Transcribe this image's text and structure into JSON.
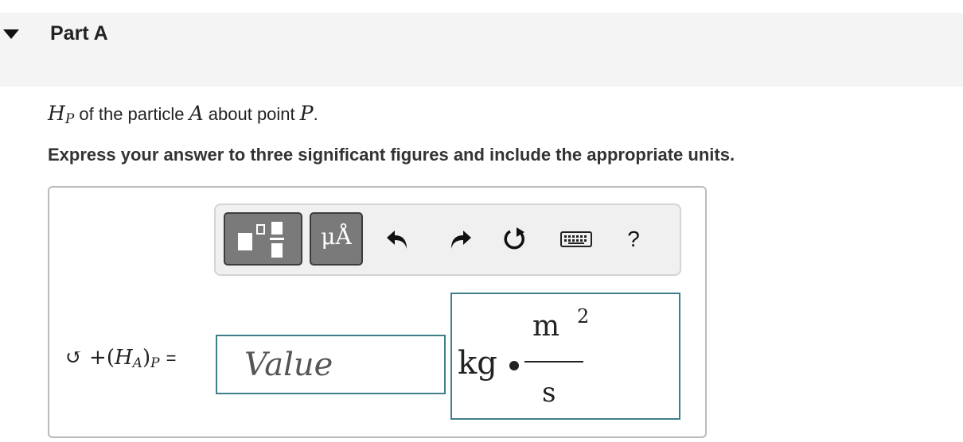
{
  "part": {
    "title": "Part A"
  },
  "question": {
    "symbol_main": "H",
    "symbol_sub": "P",
    "text_before_particle": "of the particle",
    "particle": "A",
    "text_before_point": "about point",
    "point": "P",
    "end": "."
  },
  "instructions": "Express your answer to three significant figures and include the appropriate units.",
  "toolbar": {
    "templates_icon": "templates-icon",
    "units_label": "μÅ",
    "undo_icon": "undo-icon",
    "redo_icon": "redo-icon",
    "reset_icon": "reset-icon",
    "keyboard_icon": "keyboard-icon",
    "help_label": "?"
  },
  "answer": {
    "lhs_prefix": "↺ +(",
    "lhs_main": "H",
    "lhs_sub_a": "A",
    "lhs_close": ")",
    "lhs_sub_p": "P",
    "equals": "=",
    "value_placeholder": "Value",
    "units": {
      "base": "kg",
      "numerator": "m",
      "numerator_exp": "2",
      "denominator": "s"
    }
  }
}
